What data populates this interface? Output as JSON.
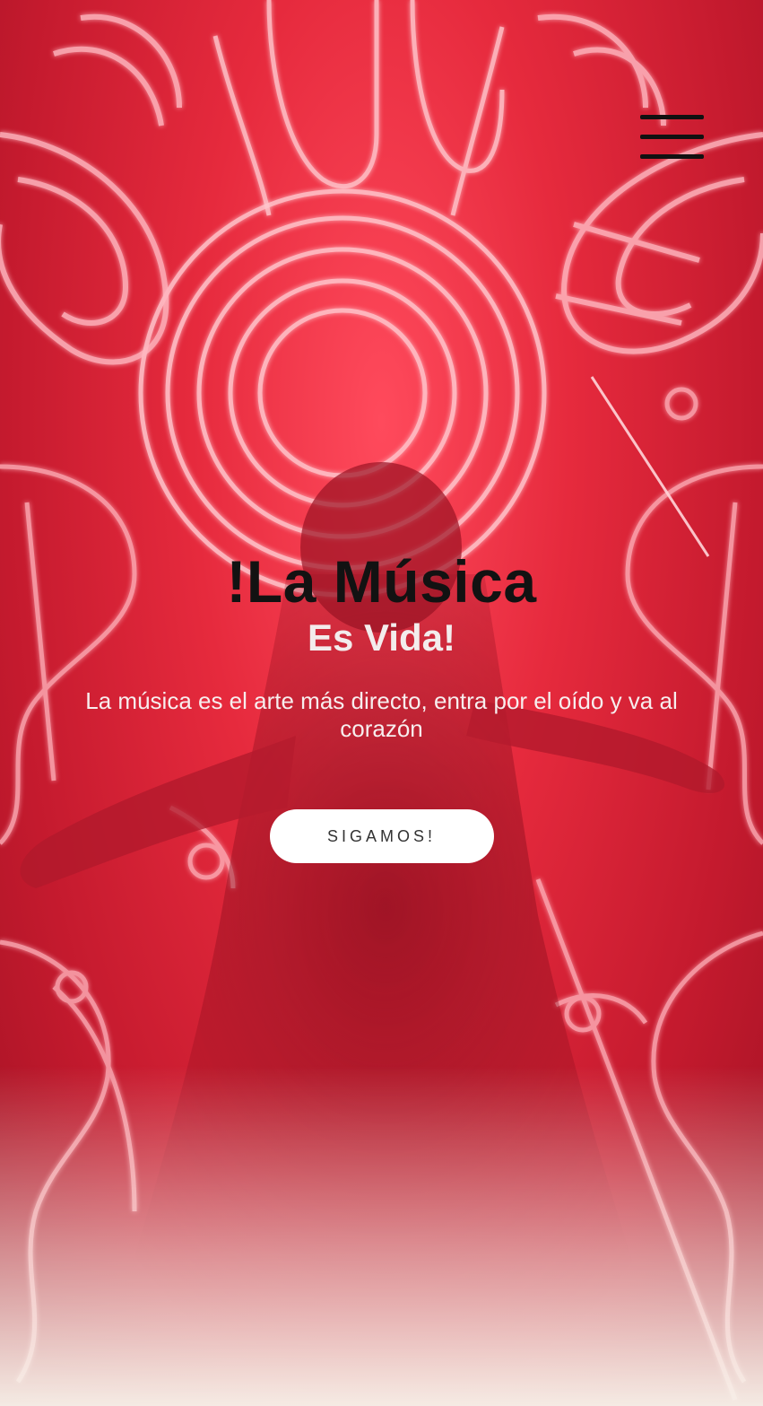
{
  "header": {
    "menu_icon": "hamburger-menu-icon"
  },
  "hero": {
    "title": "!La Música",
    "subtitle": "Es Vida!",
    "text": "La música es el arte más directo, entra por el oído y va al corazón",
    "cta_label": "SIGAMOS!"
  },
  "colors": {
    "background_red": "#e62a3d",
    "neon_pink": "#ffb3bd",
    "title": "#121212",
    "subtitle": "#f3ecec",
    "button_bg": "#ffffff",
    "fade": "#f7f2ea"
  }
}
